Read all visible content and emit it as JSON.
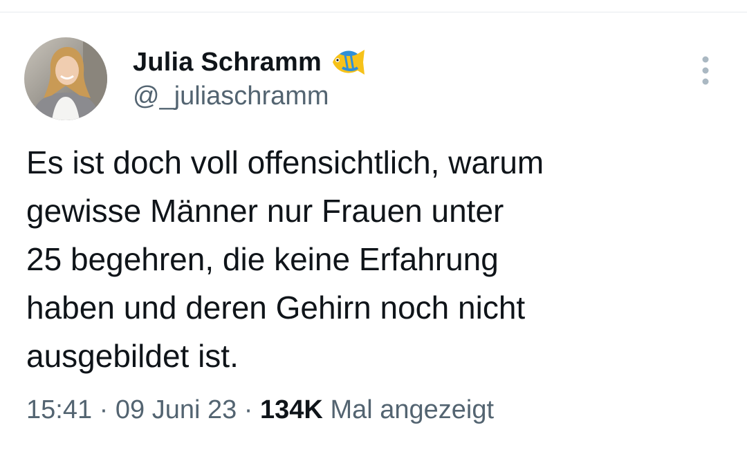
{
  "author": {
    "name": "Julia Schramm",
    "handle": "@_juliaschramm",
    "badge_icon": "fish-icon"
  },
  "tweet": {
    "lines": [
      "Es ist doch voll offensichtlich, warum",
      "gewisse Männer nur Frauen unter",
      "25 begehren, die keine Erfahrung",
      "haben und deren Gehirn noch nicht",
      "ausgebildet ist."
    ]
  },
  "meta": {
    "time": "15:41",
    "separator": " · ",
    "date": "09 Juni 23",
    "views_count": "134K",
    "views_label": "Mal angezeigt"
  },
  "icons": {
    "more": "more-vertical-icon"
  },
  "colors": {
    "text_primary": "#0f1419",
    "text_secondary": "#536471",
    "more_icon": "#aab8c2",
    "divider": "#e6ebef"
  }
}
